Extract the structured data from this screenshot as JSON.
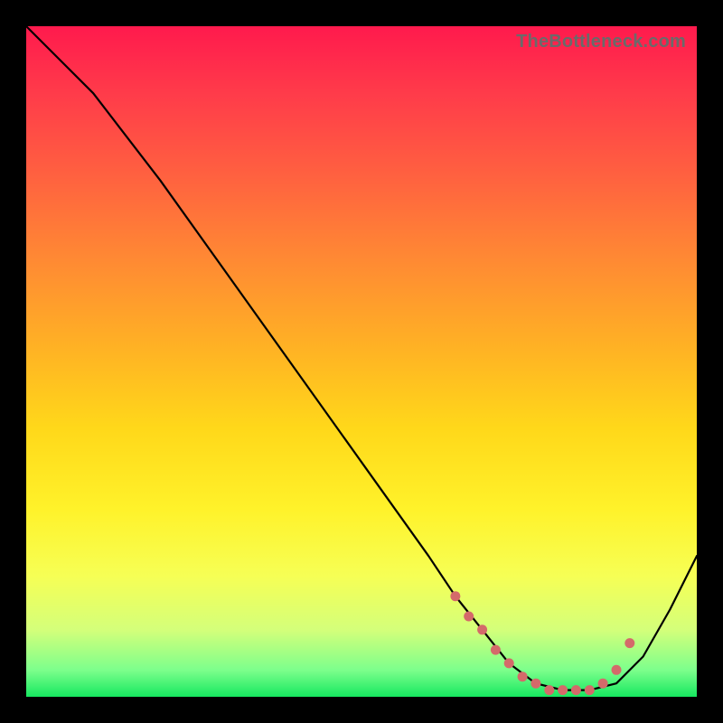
{
  "watermark": "TheBottleneck.com",
  "chart_data": {
    "type": "line",
    "title": "",
    "xlabel": "",
    "ylabel": "",
    "xlim": [
      0,
      100
    ],
    "ylim": [
      0,
      100
    ],
    "series": [
      {
        "name": "curve",
        "x": [
          0,
          6,
          10,
          20,
          30,
          40,
          50,
          60,
          64,
          68,
          72,
          76,
          80,
          84,
          88,
          92,
          96,
          100
        ],
        "y": [
          100,
          94,
          90,
          77,
          63,
          49,
          35,
          21,
          15,
          10,
          5,
          2,
          1,
          1,
          2,
          6,
          13,
          21
        ]
      }
    ],
    "optimal_band": {
      "x": [
        64,
        66,
        68,
        70,
        72,
        74,
        76,
        78,
        80,
        82,
        84,
        86,
        88,
        90
      ],
      "y": [
        15,
        12,
        10,
        7,
        5,
        3,
        2,
        1,
        1,
        1,
        1,
        2,
        4,
        8
      ]
    }
  }
}
